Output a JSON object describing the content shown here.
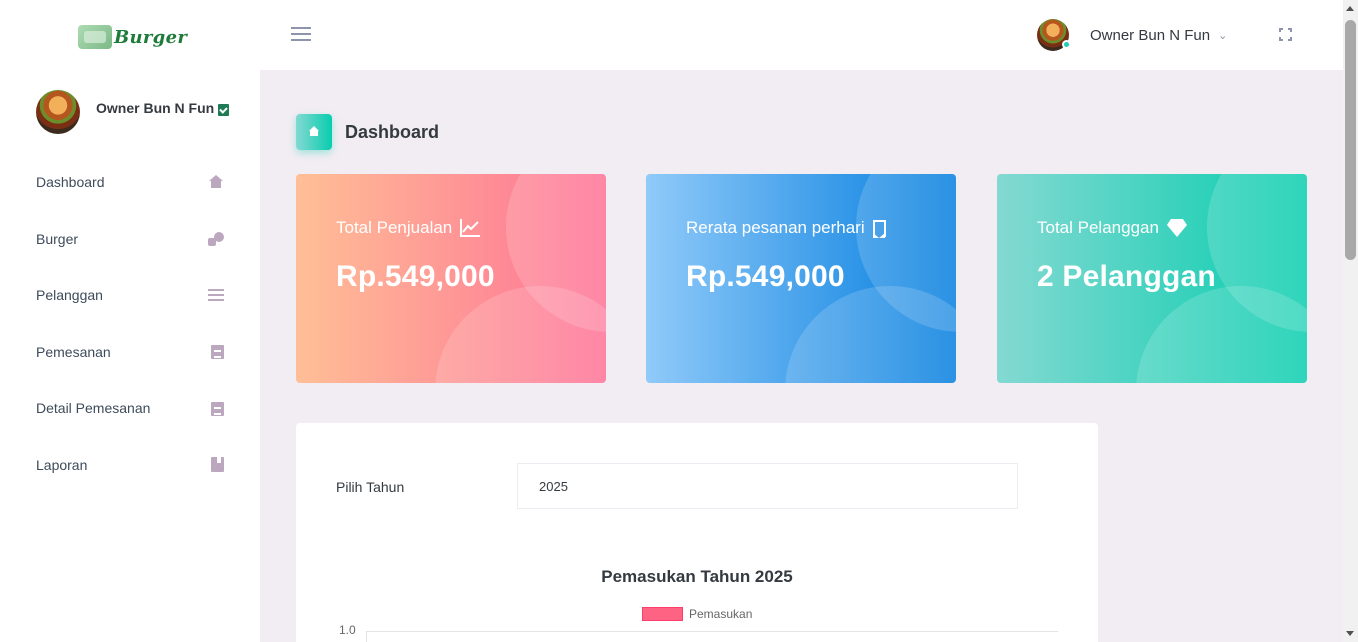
{
  "brand": {
    "name": "Burger"
  },
  "navbar": {
    "user_name": "Owner Bun N Fun",
    "menu_icon": "hamburger-menu-icon",
    "dropdown_icon": "chevron-down-icon",
    "fullscreen_icon": "fullscreen-icon"
  },
  "sidebar": {
    "profile_name": "Owner Bun N Fun",
    "items": [
      {
        "label": "Dashboard",
        "icon": "home-icon"
      },
      {
        "label": "Burger",
        "icon": "people-icon"
      },
      {
        "label": "Pelanggan",
        "icon": "list-icon"
      },
      {
        "label": "Pemesanan",
        "icon": "clipboard-icon"
      },
      {
        "label": "Detail Pemesanan",
        "icon": "clipboard-icon"
      },
      {
        "label": "Laporan",
        "icon": "book-icon"
      }
    ]
  },
  "page": {
    "title": "Dashboard"
  },
  "cards": [
    {
      "title": "Total Penjualan",
      "value": "Rp.549,000",
      "icon": "chart-line-icon"
    },
    {
      "title": "Rerata pesanan perhari",
      "value": "Rp.549,000",
      "icon": "bookmark-icon"
    },
    {
      "title": "Total Pelanggan",
      "value": "2 Pelanggan",
      "icon": "diamond-icon"
    }
  ],
  "filter": {
    "label": "Pilih Tahun",
    "value": "2025"
  },
  "chart_data": {
    "type": "bar",
    "title": "Pemasukan Tahun 2025",
    "series": [
      {
        "name": "Pemasukan",
        "color": "#ff6384"
      }
    ],
    "y_tick_labels": [
      "1.0"
    ],
    "legend_position": "top"
  }
}
